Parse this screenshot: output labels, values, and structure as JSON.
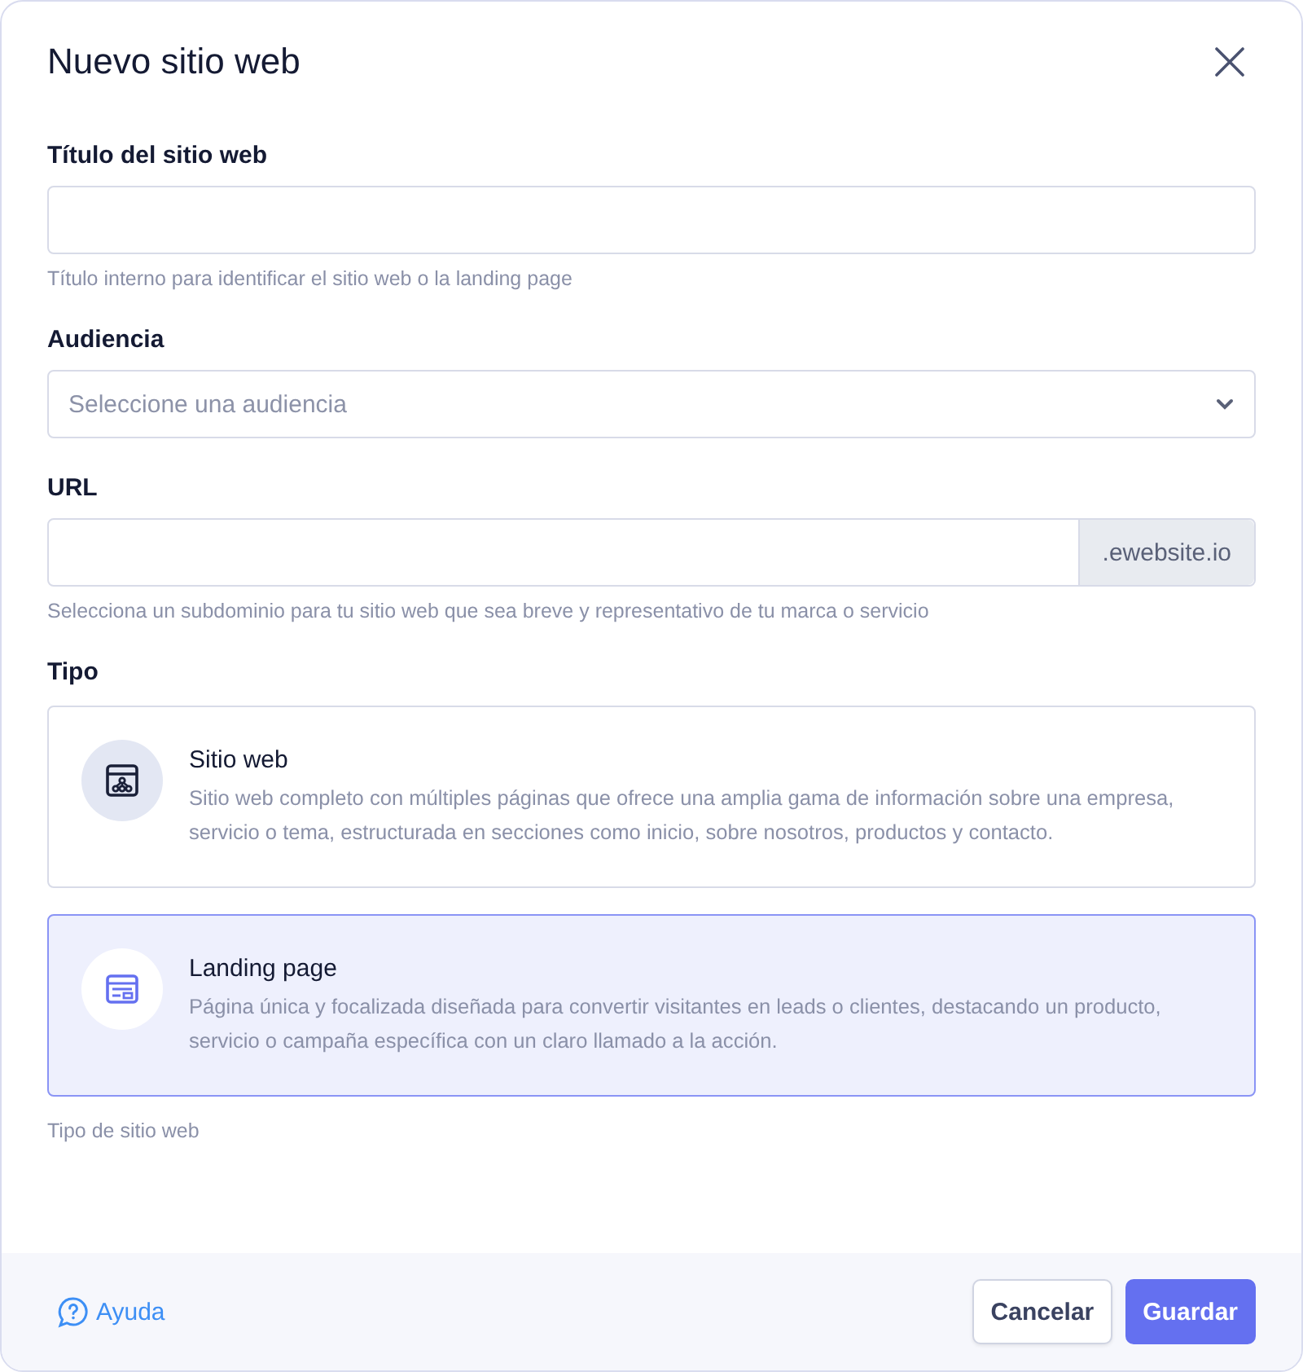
{
  "dialog": {
    "title": "Nuevo sitio web"
  },
  "fields": [
    {
      "kind": "text",
      "label": "Título del sitio web",
      "help": "Título interno para identificar el sitio web o la landing page"
    },
    {
      "kind": "select",
      "label": "Audiencia",
      "placeholder": "Seleccione una audiencia"
    },
    {
      "kind": "addon",
      "label": "URL",
      "addon": ".ewebsite.io",
      "help": "Selecciona un subdominio para tu sitio web que sea breve y representativo de tu marca o servicio"
    }
  ],
  "type_section": {
    "label": "Tipo",
    "help": "Tipo de sitio web",
    "options": [
      {
        "kind": "website",
        "title": "Sitio web",
        "description": "Sitio web completo con múltiples páginas que ofrece una amplia gama de información sobre una empresa, servicio o tema, estructurada en secciones como inicio, sobre nosotros, productos y contacto.",
        "selected": false
      },
      {
        "kind": "landing",
        "title": "Landing page",
        "description": "Página única y focalizada diseñada para convertir visitantes en leads o clientes, destacando un producto, servicio o campaña específica con un claro llamado a la acción.",
        "selected": true
      }
    ]
  },
  "footer": {
    "help_link": "Ayuda",
    "buttons": [
      {
        "kind": "secondary",
        "label": "Cancelar"
      },
      {
        "kind": "primary",
        "label": "Guardar"
      }
    ]
  }
}
